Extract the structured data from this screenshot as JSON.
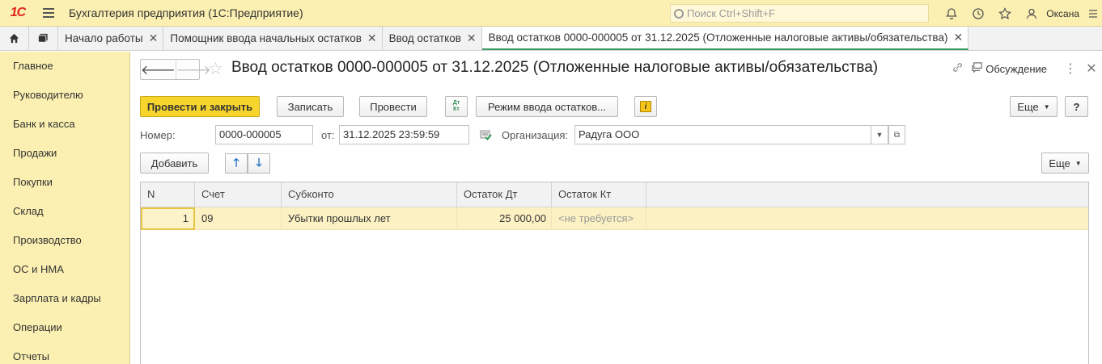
{
  "app": {
    "logo_text": "1С",
    "title": "Бухгалтерия предприятия  (1С:Предприятие)",
    "search_placeholder": "Поиск Ctrl+Shift+F",
    "user": "Оксана"
  },
  "tabs": [
    {
      "label": "Начало работы"
    },
    {
      "label": "Помощник ввода начальных остатков"
    },
    {
      "label": "Ввод остатков"
    },
    {
      "label": "Ввод остатков 0000-000005 от 31.12.2025 (Отложенные налоговые активы/обязательства)"
    }
  ],
  "sidebar": {
    "items": [
      {
        "label": "Главное"
      },
      {
        "label": "Руководителю"
      },
      {
        "label": "Банк и касса"
      },
      {
        "label": "Продажи"
      },
      {
        "label": "Покупки"
      },
      {
        "label": "Склад"
      },
      {
        "label": "Производство"
      },
      {
        "label": "ОС и НМА"
      },
      {
        "label": "Зарплата и кадры"
      },
      {
        "label": "Операции"
      },
      {
        "label": "Отчеты"
      }
    ]
  },
  "doc": {
    "title": "Ввод остатков 0000-000005 от 31.12.2025 (Отложенные налоговые активы/обязательства)",
    "discussion": "Обсуждение",
    "buttons": {
      "post_close": "Провести и закрыть",
      "save": "Записать",
      "post": "Провести",
      "dtkt_top": "Дт",
      "dtkt_bottom": "Кт",
      "mode": "Режим ввода остатков...",
      "info": "i",
      "more": "Еще",
      "help": "?",
      "add": "Добавить",
      "more2": "Еще"
    },
    "fields": {
      "number_label": "Номер:",
      "number_value": "0000-000005",
      "date_label": "от:",
      "date_value": "31.12.2025 23:59:59",
      "org_label": "Организация:",
      "org_value": "Радуга ООО"
    }
  },
  "table": {
    "columns": [
      "N",
      "Счет",
      "Субконто",
      "Остаток Дт",
      "Остаток Кт"
    ],
    "rows": [
      {
        "n": "1",
        "account": "09",
        "subconto": "Убытки прошлых лет",
        "debit": "25 000,00",
        "credit": "<не требуется>"
      }
    ]
  },
  "colors": {
    "panel_yellow": "#fbf0b1",
    "primary_button": "#f7d52d",
    "active_tab_underline": "#3a9a62",
    "selected_row": "#fbf1c3"
  }
}
